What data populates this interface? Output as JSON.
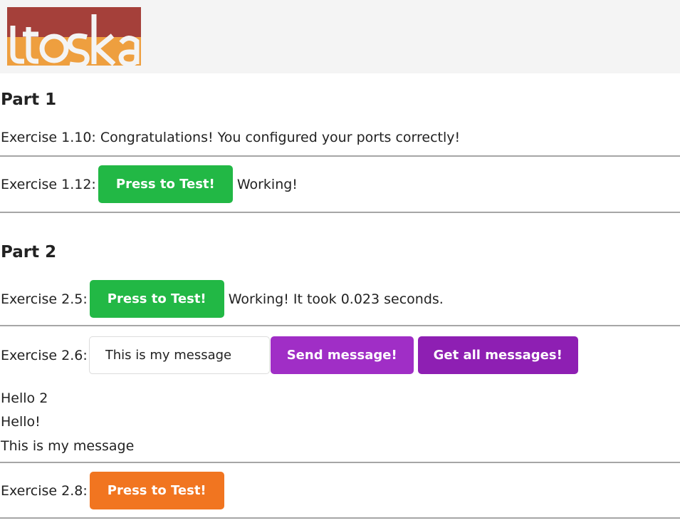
{
  "header": {
    "logo": {
      "text": "itoska",
      "colors": [
        "#a5403a",
        "#ee9f3f"
      ]
    }
  },
  "part1": {
    "title": "Part 1",
    "exercise_1_10": {
      "text": "Exercise 1.10: Congratulations! You configured your ports correctly!"
    },
    "exercise_1_12": {
      "label": "Exercise 1.12:",
      "button": "Press to Test!",
      "status": "Working!"
    }
  },
  "part2": {
    "title": "Part 2",
    "exercise_2_5": {
      "label": "Exercise 2.5:",
      "button": "Press to Test!",
      "status": "Working! It took 0.023 seconds."
    },
    "exercise_2_6": {
      "label": "Exercise 2.6:",
      "input_value": "This is my message",
      "send_button": "Send message!",
      "get_button": "Get all messages!",
      "messages": [
        "Hello 2",
        "Hello!",
        "This is my message"
      ]
    },
    "exercise_2_8": {
      "label": "Exercise 2.8:",
      "button": "Press to Test!"
    }
  },
  "colors": {
    "green": "#22b845",
    "purple": "#a02ec6",
    "dark_purple": "#8e1fb3",
    "orange": "#f17520"
  }
}
